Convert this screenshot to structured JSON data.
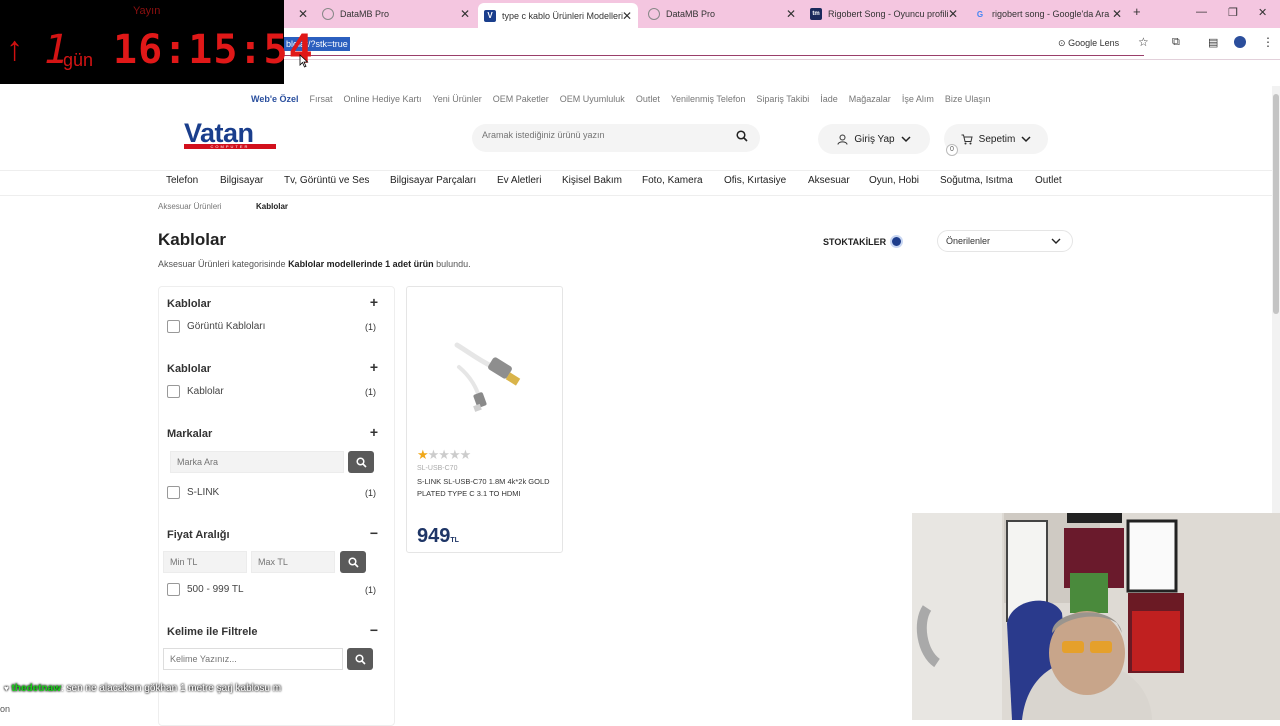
{
  "browser": {
    "tabs": [
      {
        "title": "",
        "active": false
      },
      {
        "title": "DataMB Pro",
        "active": false
      },
      {
        "title": "type c kablo Ürünleri Modelleri",
        "active": true
      },
      {
        "title": "DataMB Pro",
        "active": false
      },
      {
        "title": "Rigobert Song - Oyuncu profili",
        "active": false
      },
      {
        "title": "rigobert song - Google'da Ara",
        "active": false
      }
    ],
    "new_tab": "+",
    "url": "blolar/?stk=true",
    "google_lens": "Google Lens"
  },
  "overlay": {
    "label": "Yayın",
    "arrow": "↑",
    "days": "1",
    "days_unit": "gün",
    "time": "16:15:54"
  },
  "site": {
    "top_links": [
      "Web'e Özel",
      "Fırsat",
      "Online Hediye Kartı",
      "Yeni Ürünler",
      "OEM Paketler",
      "OEM Uyumluluk",
      "Outlet",
      "Yenilenmiş Telefon",
      "Sipariş Takibi",
      "İade",
      "Mağazalar",
      "İşe Alım",
      "Bize Ulaşın"
    ],
    "logo": "Vatan",
    "logo_sub": "COMPUTER",
    "search_placeholder": "Aramak istediğiniz ürünü yazın",
    "login": "Giriş Yap",
    "cart": "Sepetim",
    "cart_count": "0",
    "categories": [
      "Telefon",
      "Bilgisayar",
      "Tv, Görüntü ve Ses",
      "Bilgisayar Parçaları",
      "Ev Aletleri",
      "Kişisel Bakım",
      "Foto, Kamera",
      "Ofis, Kırtasiye",
      "Aksesuar",
      "Oyun, Hobi",
      "Soğutma, Isıtma",
      "Outlet"
    ],
    "breadcrumb": [
      "Aksesuar Ürünleri",
      "Kablolar"
    ]
  },
  "listing": {
    "title": "Kablolar",
    "summary_pre": "Aksesuar Ürünleri kategorisinde ",
    "summary_bold": "Kablolar modellerinde 1 adet ürün",
    "summary_post": " bulundu.",
    "stock_label": "STOKTAKİLER",
    "sort_value": "Önerilenler"
  },
  "filters": {
    "group1": {
      "title": "Kablolar",
      "option": "Görüntü Kabloları",
      "count": "(1)"
    },
    "group2": {
      "title": "Kablolar",
      "option": "Kablolar",
      "count": "(1)"
    },
    "brands": {
      "title": "Markalar",
      "search_placeholder": "Marka Ara",
      "option": "S-LINK",
      "count": "(1)"
    },
    "price": {
      "title": "Fiyat Aralığı",
      "min_placeholder": "Min TL",
      "max_placeholder": "Max TL",
      "option": "500 - 999 TL",
      "count": "(1)"
    },
    "keyword": {
      "title": "Kelime ile Filtrele",
      "placeholder": "Kelime Yazınız..."
    }
  },
  "product": {
    "rating": 1,
    "sku": "SL-USB-C70",
    "name": "S-LINK SL-USB-C70 1.8M 4k*2k GOLD PLATED TYPE C 3.1 TO HDMI",
    "price": "949",
    "currency": "TL"
  },
  "chat": {
    "user": "thedetnaw",
    "message": ": sen ne alacaksın gökhan 1 metre şarj kablosu m",
    "line2": "on"
  },
  "colors": {
    "tabbar": "#f4c6e0",
    "brand_blue": "#1a3e8c",
    "brand_red": "#d2101c",
    "timer_red": "#e01818",
    "price_blue": "#1e3566",
    "chat_user": "#19d419"
  }
}
